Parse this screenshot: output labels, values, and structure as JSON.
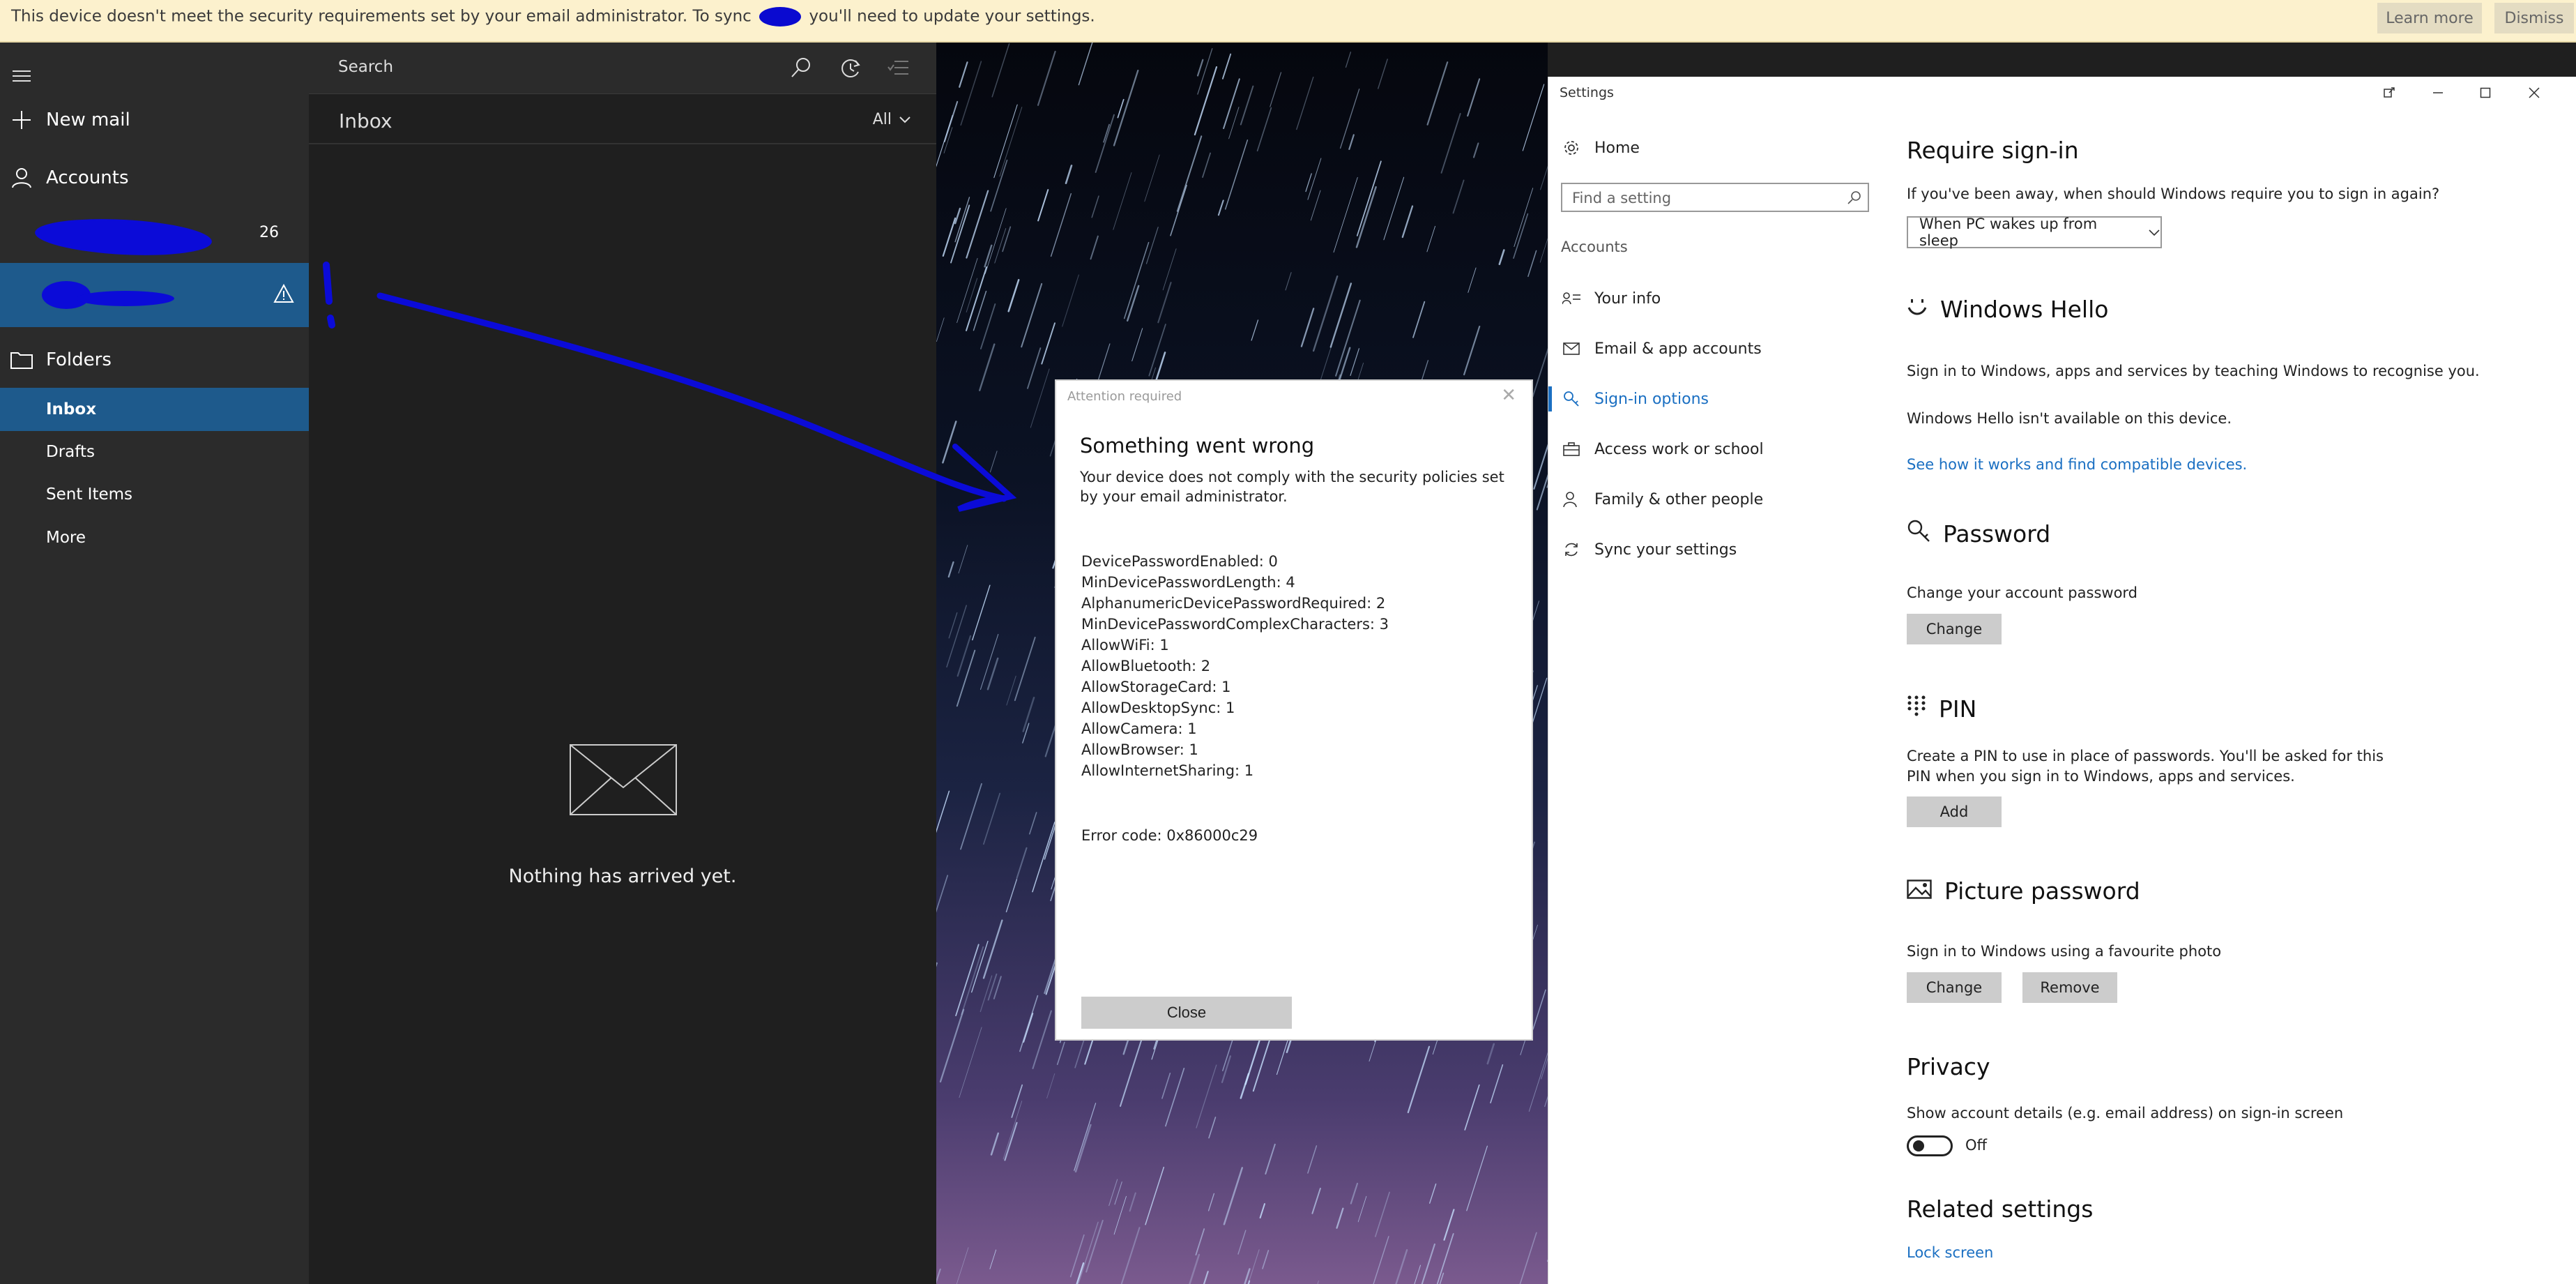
{
  "infobar": {
    "message_before": "This device doesn't meet the security requirements set by your email administrator. To sync",
    "message_after": "you'll need to update your settings.",
    "learn_more": "Learn more",
    "dismiss": "Dismiss"
  },
  "mail_nav": {
    "new_mail": "New mail",
    "accounts": "Accounts",
    "account_1_badge": "26",
    "folders": "Folders",
    "folder_items": [
      "Inbox",
      "Drafts",
      "Sent Items",
      "More"
    ]
  },
  "message_list": {
    "search_placeholder": "Search",
    "title": "Inbox",
    "filter": "All",
    "empty_text": "Nothing has arrived yet."
  },
  "dialog": {
    "caption": "Attention required",
    "heading": "Something went wrong",
    "description": "Your device does not comply with the security policies set by your email administrator.",
    "policies": [
      "DevicePasswordEnabled: 0",
      "MinDevicePasswordLength: 4",
      "AlphanumericDevicePasswordRequired: 2",
      "MinDevicePasswordComplexCharacters: 3",
      "AllowWiFi: 1",
      "AllowBluetooth: 2",
      "AllowStorageCard: 1",
      "AllowDesktopSync: 1",
      "AllowCamera: 1",
      "AllowBrowser: 1",
      "AllowInternetSharing: 1"
    ],
    "error_code": "Error code: 0x86000c29",
    "close_label": "Close"
  },
  "settings": {
    "window_title": "Settings",
    "nav": {
      "home": "Home",
      "search_placeholder": "Find a setting",
      "section": "Accounts",
      "items": [
        "Your info",
        "Email & app accounts",
        "Sign-in options",
        "Access work or school",
        "Family & other people",
        "Sync your settings"
      ],
      "selected": "Sign-in options"
    },
    "require_signin": {
      "heading": "Require sign-in",
      "question": "If you've been away, when should Windows require you to sign in again?",
      "value": "When PC wakes up from sleep"
    },
    "hello": {
      "heading": "Windows Hello",
      "line1": "Sign in to Windows, apps and services by teaching Windows to recognise you.",
      "line2": "Windows Hello isn't available on this device.",
      "link": "See how it works and find compatible devices."
    },
    "password": {
      "heading": "Password",
      "text": "Change your account password",
      "button": "Change"
    },
    "pin": {
      "heading": "PIN",
      "text_line1": "Create a PIN to use in place of passwords. You'll be asked for this",
      "text_line2": "PIN when you sign in to Windows, apps and services.",
      "button": "Add"
    },
    "picture_password": {
      "heading": "Picture password",
      "text": "Sign in to Windows using a favourite photo",
      "change": "Change",
      "remove": "Remove"
    },
    "privacy": {
      "heading": "Privacy",
      "text": "Show account details (e.g. email address) on sign-in screen",
      "toggle_state": "Off"
    },
    "related": {
      "heading": "Related settings",
      "link": "Lock screen"
    }
  },
  "colors": {
    "infobar_bg": "#fcf1cd",
    "mail_selected": "#1e5a8c",
    "accent_link": "#1a6fc2",
    "annotation_blue": "#0b0bd8"
  }
}
